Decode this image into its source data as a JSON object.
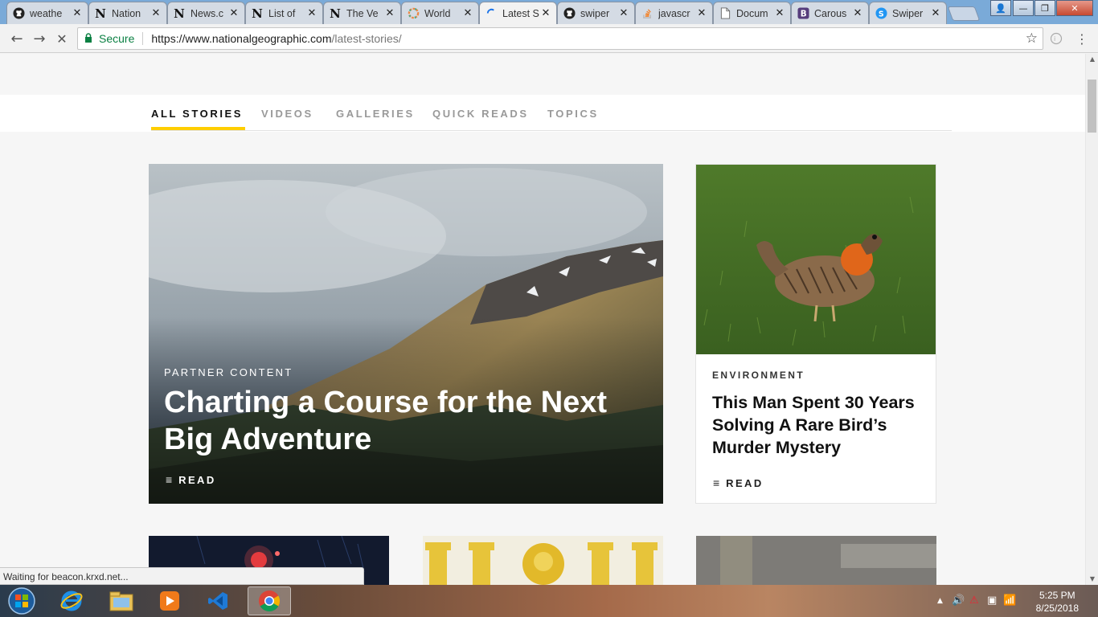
{
  "browser": {
    "tabs": [
      {
        "label": "weathe",
        "icon": "github-icon"
      },
      {
        "label": "Nation",
        "icon": "natgeo-n-icon"
      },
      {
        "label": "News.c",
        "icon": "natgeo-n-icon"
      },
      {
        "label": "List of",
        "icon": "natgeo-n-icon"
      },
      {
        "label": "The Ve",
        "icon": "natgeo-n-icon"
      },
      {
        "label": "World",
        "icon": "colorful-ring-icon"
      },
      {
        "label": "Latest S",
        "icon": "loading-spinner-icon",
        "active": true
      },
      {
        "label": "swiper",
        "icon": "github-icon"
      },
      {
        "label": "javascr",
        "icon": "stackoverflow-icon"
      },
      {
        "label": "Docum",
        "icon": "document-icon"
      },
      {
        "label": "Carous",
        "icon": "bootstrap-icon"
      },
      {
        "label": "Swiper",
        "icon": "swiper-icon"
      }
    ],
    "close_glyph": "✕",
    "window_controls": {
      "user": "👤",
      "minimize": "—",
      "maximize": "❐",
      "close": "✕"
    },
    "address": {
      "secure_label": "Secure",
      "url_host": "https://www.nationalgeographic.com",
      "url_path": "/latest-stories/"
    },
    "nav": {
      "back": "←",
      "forward": "→",
      "stop": "✕",
      "star": "☆",
      "menu": "⋮"
    },
    "status_text": "Waiting for beacon.krxd.net..."
  },
  "subnav": {
    "tabs": [
      "ALL STORIES",
      "VIDEOS",
      "GALLERIES",
      "QUICK READS",
      "TOPICS"
    ],
    "active_index": 0,
    "accent": "#ffce00"
  },
  "hero": {
    "kicker": "PARTNER CONTENT",
    "title": "Charting a Course for the Next Big Adventure",
    "read_label": "READ",
    "read_icon": "≡"
  },
  "side_card": {
    "kicker": "ENVIRONMENT",
    "title": "This Man Spent 30 Years Solving A Rare Bird’s Murder Mystery",
    "read_label": "READ",
    "read_icon": "≡"
  },
  "taskbar": {
    "apps": [
      "start-orb-icon",
      "internet-explorer-icon",
      "file-explorer-icon",
      "media-player-icon",
      "visual-studio-code-icon",
      "chrome-icon"
    ],
    "clock_time": "5:25 PM",
    "clock_date": "8/25/2018"
  }
}
